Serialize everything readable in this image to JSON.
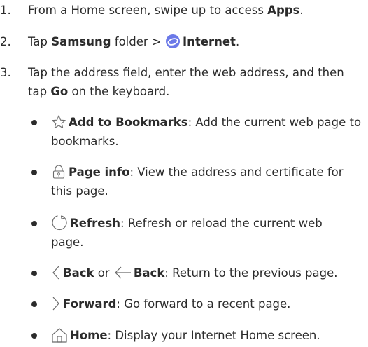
{
  "steps": [
    {
      "num": "1.",
      "pre": "From a Home screen, swipe up to access ",
      "bold": "Apps",
      "post": "."
    },
    {
      "num": "2.",
      "pre": "Tap ",
      "bold1": "Samsung",
      "mid": " folder > ",
      "bold2": "Internet",
      "post": "."
    },
    {
      "num": "3.",
      "pre": "Tap the address field, enter the web address, and then tap ",
      "bold": "Go",
      "post": " on the keyboard."
    }
  ],
  "bullets": [
    {
      "icon": "star-outline-icon",
      "label": "Add to Bookmarks",
      "text": ": Add the current web page to bookmarks."
    },
    {
      "icon": "lock-icon",
      "label": "Page info",
      "text": ": View the address and certificate for this page."
    },
    {
      "icon": "refresh-icon",
      "label": "Refresh",
      "text": ": Refresh or reload the current web page."
    },
    {
      "icon": "back-chevron-icon",
      "label": "Back",
      "or": " or ",
      "icon2": "back-arrow-icon",
      "label2": "Back",
      "text": ": Return to the previous page."
    },
    {
      "icon": "forward-chevron-icon",
      "label": "Forward",
      "text": ": Go forward to a recent page."
    },
    {
      "icon": "home-icon",
      "label": "Home",
      "text": ": Display your Internet Home screen."
    }
  ],
  "colors": {
    "text": "#2b2b2b",
    "icon": "#6b6b6b",
    "internet_accent": "#6b79e8"
  }
}
